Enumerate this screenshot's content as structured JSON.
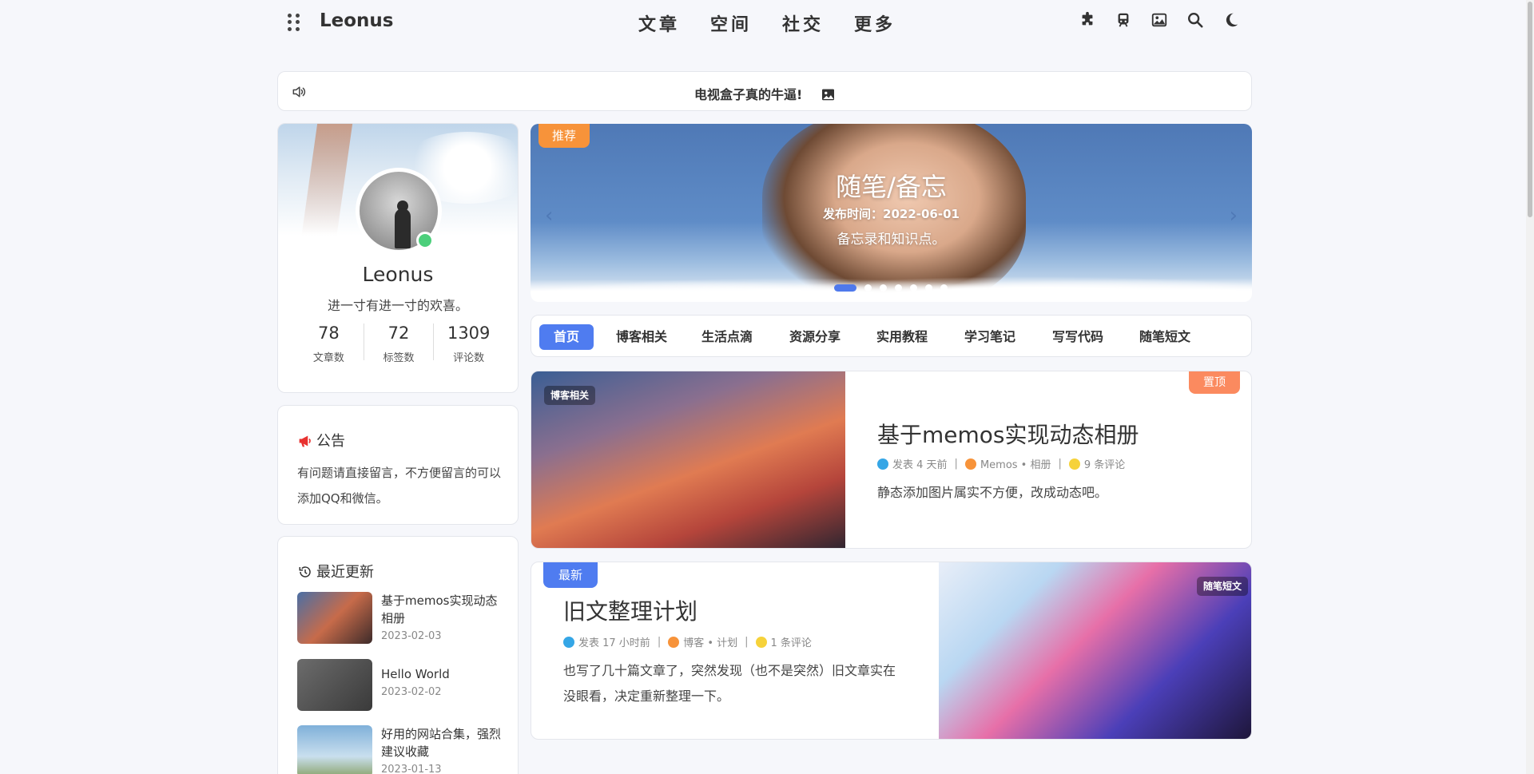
{
  "header": {
    "brand": "Leonus",
    "nav": [
      "文章",
      "空间",
      "社交",
      "更多"
    ],
    "icons": [
      "puzzle-icon",
      "train-icon",
      "image-icon",
      "search-icon",
      "moon-icon"
    ]
  },
  "notice": {
    "text": "电视盒子真的牛逼!"
  },
  "profile": {
    "name": "Leonus",
    "motto": "进一寸有进一寸的欢喜。",
    "stats": [
      {
        "num": "78",
        "label": "文章数"
      },
      {
        "num": "72",
        "label": "标签数"
      },
      {
        "num": "1309",
        "label": "评论数"
      }
    ]
  },
  "announcement": {
    "title": "公告",
    "body": "有问题请直接留言，不方便留言的可以添加QQ和微信。"
  },
  "recent": {
    "title": "最近更新",
    "items": [
      {
        "title": "基于memos实现动态相册",
        "date": "2023-02-03"
      },
      {
        "title": "Hello World",
        "date": "2023-02-02"
      },
      {
        "title": "好用的网站合集，强烈建议收藏",
        "date": "2023-01-13"
      }
    ]
  },
  "slider": {
    "tag": "推荐",
    "title": "随笔/备忘",
    "date": "发布时间：2022-06-01",
    "desc": "备忘录和知识点。",
    "dot_count": 7,
    "active_dot": 0
  },
  "tabs": [
    "首页",
    "博客相关",
    "生活点滴",
    "资源分享",
    "实用教程",
    "学习笔记",
    "写写代码",
    "随笔短文"
  ],
  "posts": [
    {
      "badge": "置顶",
      "category": "博客相关",
      "title": "基于memos实现动态相册",
      "meta_date": "发表 4 天前",
      "meta_tags": "Memos • 相册",
      "meta_comments": "9 条评论",
      "desc": "静态添加图片属实不方便，改成动态吧。"
    },
    {
      "badge": "最新",
      "category": "随笔短文",
      "title": "旧文整理计划",
      "meta_date": "发表 17 小时前",
      "meta_tags": "博客 • 计划",
      "meta_comments": "1 条评论",
      "desc": "也写了几十篇文章了，突然发现（也不是突然）旧文章实在没眼看，决定重新整理一下。"
    }
  ],
  "colors": {
    "accent": "#4f7cf0",
    "orange": "#f7933a",
    "top_badge": "#fb8a5f",
    "online": "#4ccf7b"
  }
}
